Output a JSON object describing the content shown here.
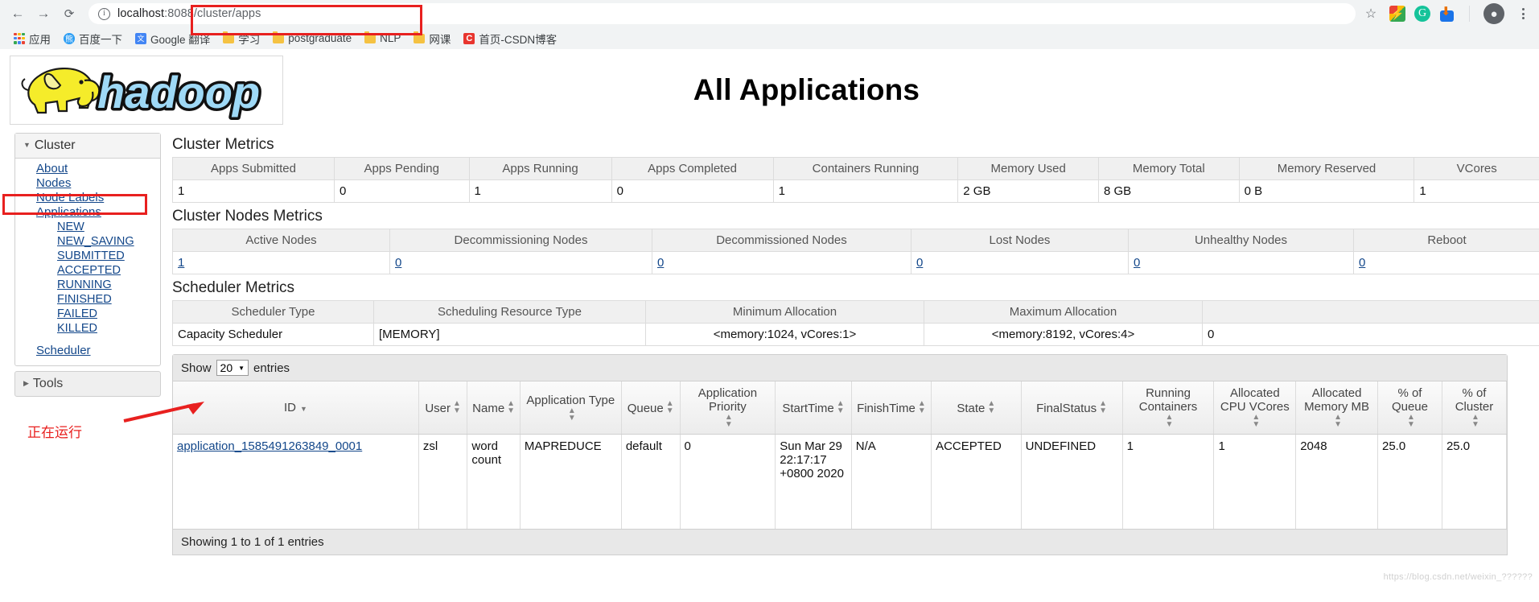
{
  "browser": {
    "back_icon": "←",
    "forward_icon": "→",
    "reload_icon": "⟳",
    "url_display": "localhost:8088/cluster/apps",
    "url_host": "localhost",
    "url_path": ":8088/cluster/apps",
    "info_icon_glyph": "i",
    "star_icon": "☆",
    "avatar_icon": "●",
    "extensions": [
      "colorful-extension-icon",
      "grammarly-icon",
      "download-manager-icon"
    ],
    "bookmarks": [
      {
        "label": "应用",
        "icon": "apps-grid-icon"
      },
      {
        "label": "百度一下",
        "icon": "baidu-favicon"
      },
      {
        "label": "Google 翻译",
        "icon": "google-translate-favicon"
      },
      {
        "label": "学习",
        "icon": "folder-icon"
      },
      {
        "label": "postgraduate",
        "icon": "folder-icon"
      },
      {
        "label": "NLP",
        "icon": "folder-icon"
      },
      {
        "label": "网课",
        "icon": "folder-icon"
      },
      {
        "label": "首页-CSDN博客",
        "icon": "csdn-favicon"
      }
    ]
  },
  "page": {
    "title": "All Applications",
    "logo_alt": "hadoop"
  },
  "sidebar": {
    "cluster_header": "Cluster",
    "cluster_links": [
      "About",
      "Nodes",
      "Node Labels",
      "Applications"
    ],
    "state_links": [
      "NEW",
      "NEW_SAVING",
      "SUBMITTED",
      "ACCEPTED",
      "RUNNING",
      "FINISHED",
      "FAILED",
      "KILLED"
    ],
    "scheduler_link": "Scheduler",
    "tools_header": "Tools"
  },
  "annotations": {
    "running_note": "正在运行",
    "highlight_color": "#e8201f"
  },
  "cluster_metrics": {
    "heading": "Cluster Metrics",
    "columns": [
      "Apps Submitted",
      "Apps Pending",
      "Apps Running",
      "Apps Completed",
      "Containers Running",
      "Memory Used",
      "Memory Total",
      "Memory Reserved",
      "VCores"
    ],
    "values": [
      "1",
      "0",
      "1",
      "0",
      "1",
      "2 GB",
      "8 GB",
      "0 B",
      "1"
    ]
  },
  "cluster_nodes_metrics": {
    "heading": "Cluster Nodes Metrics",
    "columns": [
      "Active Nodes",
      "Decommissioning Nodes",
      "Decommissioned Nodes",
      "Lost Nodes",
      "Unhealthy Nodes",
      "Reboot"
    ],
    "values": [
      "1",
      "0",
      "0",
      "0",
      "0",
      "0"
    ]
  },
  "scheduler_metrics": {
    "heading": "Scheduler Metrics",
    "columns": [
      "Scheduler Type",
      "Scheduling Resource Type",
      "Minimum Allocation",
      "Maximum Allocation",
      ""
    ],
    "values": [
      "Capacity Scheduler",
      "[MEMORY]",
      "<memory:1024, vCores:1>",
      "<memory:8192, vCores:4>",
      "0"
    ]
  },
  "apps_table": {
    "show_label": "Show",
    "entries_label": "entries",
    "page_size": "20",
    "columns": [
      "ID",
      "User",
      "Name",
      "Application Type",
      "Queue",
      "Application Priority",
      "StartTime",
      "FinishTime",
      "State",
      "FinalStatus",
      "Running Containers",
      "Allocated CPU VCores",
      "Allocated Memory MB",
      "% of Queue",
      "% of Cluster"
    ],
    "rows": [
      {
        "id": "application_1585491263849_0001",
        "user": "zsl",
        "name": "word count",
        "app_type": "MAPREDUCE",
        "queue": "default",
        "priority": "0",
        "start_time": "Sun Mar 29 22:17:17 +0800 2020",
        "finish_time": "N/A",
        "state": "ACCEPTED",
        "final_status": "UNDEFINED",
        "running_containers": "1",
        "alloc_vcores": "1",
        "alloc_memory_mb": "2048",
        "pct_queue": "25.0",
        "pct_cluster": "25.0"
      }
    ],
    "footer": "Showing 1 to 1 of 1 entries"
  },
  "watermark": "https://blog.csdn.net/weixin_??????"
}
